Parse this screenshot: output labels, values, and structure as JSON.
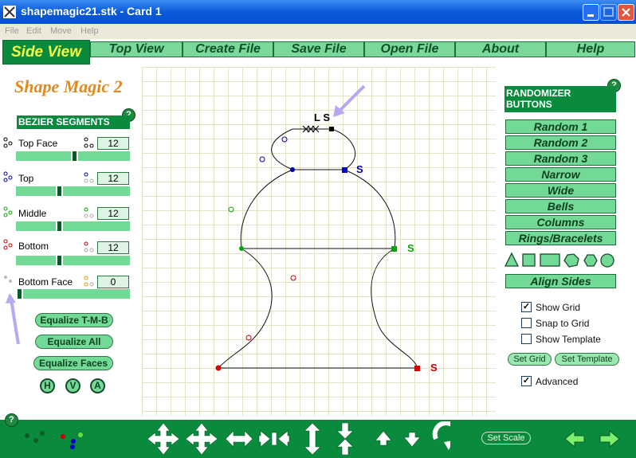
{
  "window": {
    "title": "shapemagic21.stk - Card 1"
  },
  "menu": [
    "File",
    "Edit",
    "Move",
    "Help"
  ],
  "nav": {
    "side_view": "Side View",
    "tabs": [
      "Top View",
      "Create File",
      "Save File",
      "Open File",
      "About",
      "Help"
    ]
  },
  "app_title": "Shape Magic 2",
  "help": "?",
  "bezier": {
    "header": "BEZIER SEGMENTS",
    "segments": [
      {
        "label": "Top Face",
        "value": "12"
      },
      {
        "label": "Top",
        "value": "12"
      },
      {
        "label": "Middle",
        "value": "12"
      },
      {
        "label": "Bottom",
        "value": "12"
      },
      {
        "label": "Bottom Face",
        "value": "0"
      }
    ]
  },
  "equalize": {
    "tmb": "Equalize T-M-B",
    "all": "Equalize All",
    "faces": "Equalize Faces"
  },
  "flip": {
    "h": "H",
    "v": "V",
    "a": "A"
  },
  "canvas": {
    "top_labels": "L S",
    "s": "S"
  },
  "randomizer": {
    "header": "RANDOMIZER BUTTONS",
    "buttons": [
      "Random 1",
      "Random 2",
      "Random 3",
      "Narrow",
      "Wide",
      "Bells",
      "Columns",
      "Rings/Bracelets"
    ],
    "align": "Align Sides"
  },
  "options": {
    "show_grid": {
      "label": "Show Grid",
      "checked": true
    },
    "snap": {
      "label": "Snap to Grid",
      "checked": false
    },
    "template": {
      "label": "Show Template",
      "checked": false
    },
    "set_grid": "Set Grid",
    "set_template": "Set Template",
    "advanced": {
      "label": "Advanced",
      "checked": true
    }
  },
  "bottom": {
    "set_scale": "Set Scale"
  },
  "colors": {
    "green": "#0a8a3c",
    "light_green": "#72d996",
    "accent": "#f4ff48",
    "title_orange": "#e08a1e"
  },
  "icons": [
    "app-icon",
    "minimize-icon",
    "maximize-icon",
    "close-icon",
    "move-all-icon",
    "expand-icon",
    "compress-icon",
    "rotate-icon",
    "back-icon",
    "forward-icon"
  ]
}
